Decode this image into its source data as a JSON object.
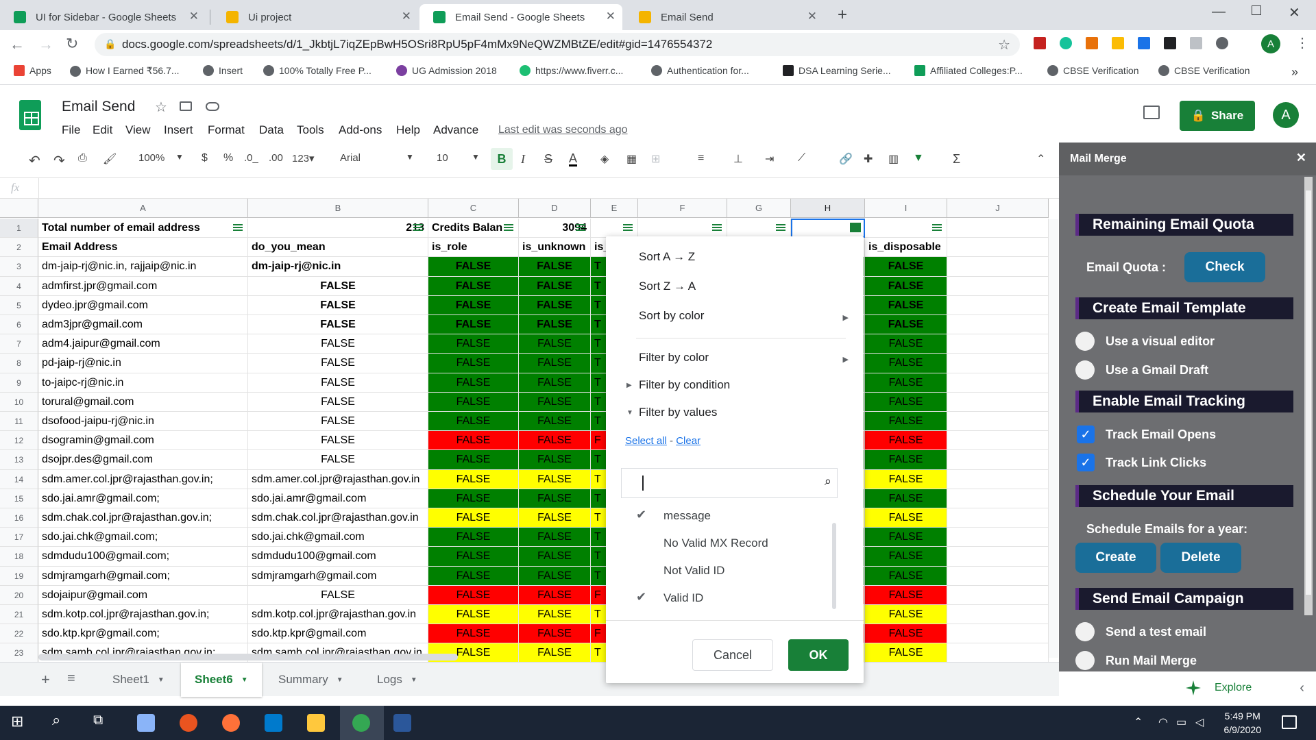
{
  "browser_tabs": [
    {
      "title": "UI for Sidebar - Google Sheets",
      "icon": "sheets-icon"
    },
    {
      "title": "Ui project",
      "icon": "slides-icon"
    },
    {
      "title": "Email Send - Google Sheets",
      "icon": "sheets-icon"
    },
    {
      "title": "Email Send",
      "icon": "slides-icon"
    }
  ],
  "url": "docs.google.com/spreadsheets/d/1_JkbtjL7iqZEpBwH5OSri8RpU5pF4mMx9NeQWZMBtZE/edit#gid=1476554372",
  "bookmarks": [
    "Apps",
    "How I Earned ₹56.7...",
    "Insert",
    "100% Totally Free P...",
    "UG Admission 2018",
    "https://www.fiverr.c...",
    "Authentication for...",
    "DSA Learning Serie...",
    "Affiliated Colleges:P...",
    "CBSE Verification",
    "CBSE Verification"
  ],
  "doc": {
    "title": "Email Send",
    "menus": [
      "File",
      "Edit",
      "View",
      "Insert",
      "Format",
      "Data",
      "Tools",
      "Add-ons",
      "Help",
      "Advance"
    ],
    "last_edit": "Last edit was seconds ago",
    "share": "Share",
    "avatar": "A"
  },
  "toolbar": {
    "zoom": "100%",
    "currency": "$",
    "percent": "%",
    "dec1": ".0_",
    "dec2": ".00",
    "fmt": "123▾",
    "font": "Arial",
    "size": "10",
    "bold": "B",
    "italic": "I",
    "strike": "S",
    "textcolor": "A"
  },
  "fx": "fx",
  "columns": [
    "A",
    "B",
    "C",
    "D",
    "E",
    "F",
    "G",
    "H",
    "I",
    "J"
  ],
  "rows": [
    {
      "n": "1",
      "a": "Total number of email address",
      "b": "213",
      "c": "Credits Balan",
      "d": "3094",
      "e": "",
      "i": ""
    },
    {
      "n": "2",
      "a": "Email Address",
      "b": "do_you_mean",
      "c": "is_role",
      "d": "is_unknown",
      "e": "is_",
      "i": "is_disposable"
    },
    {
      "n": "3",
      "a": "dm-jaip-rj@nic.in, rajjaip@nic.in",
      "b": "dm-jaip-rj@nic.in",
      "c": "FALSE",
      "d": "FALSE",
      "e": "T",
      "i": "FALSE",
      "col": "g"
    },
    {
      "n": "4",
      "a": "admfirst.jpr@gmail.com",
      "b": "FALSE",
      "c": "FALSE",
      "d": "FALSE",
      "e": "T",
      "i": "FALSE",
      "col": "g"
    },
    {
      "n": "5",
      "a": "dydeo.jpr@gmail.com",
      "b": "FALSE",
      "c": "FALSE",
      "d": "FALSE",
      "e": "T",
      "i": "FALSE",
      "col": "g"
    },
    {
      "n": "6",
      "a": "adm3jpr@gmail.com",
      "b": "FALSE",
      "c": "FALSE",
      "d": "FALSE",
      "e": "T",
      "i": "FALSE",
      "col": "g"
    },
    {
      "n": "7",
      "a": "adm4.jaipur@gmail.com",
      "b": "FALSE",
      "c": "FALSE",
      "d": "FALSE",
      "e": "T",
      "i": "FALSE",
      "col": "g"
    },
    {
      "n": "8",
      "a": "pd-jaip-rj@nic.in",
      "b": "FALSE",
      "c": "FALSE",
      "d": "FALSE",
      "e": "T",
      "i": "FALSE",
      "col": "g"
    },
    {
      "n": "9",
      "a": "to-jaipc-rj@nic.in",
      "b": "FALSE",
      "c": "FALSE",
      "d": "FALSE",
      "e": "T",
      "i": "FALSE",
      "col": "g"
    },
    {
      "n": "10",
      "a": "torural@gmail.com",
      "b": "FALSE",
      "c": "FALSE",
      "d": "FALSE",
      "e": "T",
      "i": "FALSE",
      "col": "g"
    },
    {
      "n": "11",
      "a": "dsofood-jaipu-rj@nic.in",
      "b": "FALSE",
      "c": "FALSE",
      "d": "FALSE",
      "e": "T",
      "i": "FALSE",
      "col": "g"
    },
    {
      "n": "12",
      "a": "dsogramin@gmail.com",
      "b": "FALSE",
      "c": "FALSE",
      "d": "FALSE",
      "e": "F",
      "i": "FALSE",
      "col": "rd"
    },
    {
      "n": "13",
      "a": "dsojpr.des@gmail.com",
      "b": "FALSE",
      "c": "FALSE",
      "d": "FALSE",
      "e": "T",
      "i": "FALSE",
      "col": "g"
    },
    {
      "n": "14",
      "a": "sdm.amer.col.jpr@rajasthan.gov.in;",
      "b": "sdm.amer.col.jpr@rajasthan.gov.in",
      "c": "FALSE",
      "d": "FALSE",
      "e": "T",
      "i": "FALSE",
      "col": "y"
    },
    {
      "n": "15",
      "a": "sdo.jai.amr@gmail.com;",
      "b": "sdo.jai.amr@gmail.com",
      "c": "FALSE",
      "d": "FALSE",
      "e": "T",
      "i": "FALSE",
      "col": "g"
    },
    {
      "n": "16",
      "a": "sdm.chak.col.jpr@rajasthan.gov.in;",
      "b": "sdm.chak.col.jpr@rajasthan.gov.in",
      "c": "FALSE",
      "d": "FALSE",
      "e": "T",
      "i": "FALSE",
      "col": "y"
    },
    {
      "n": "17",
      "a": "sdo.jai.chk@gmail.com;",
      "b": "sdo.jai.chk@gmail.com",
      "c": "FALSE",
      "d": "FALSE",
      "e": "T",
      "i": "FALSE",
      "col": "g"
    },
    {
      "n": "18",
      "a": "sdmdudu100@gmail.com;",
      "b": "sdmdudu100@gmail.com",
      "c": "FALSE",
      "d": "FALSE",
      "e": "T",
      "i": "FALSE",
      "col": "g"
    },
    {
      "n": "19",
      "a": "sdmjramgarh@gmail.com;",
      "b": "sdmjramgarh@gmail.com",
      "c": "FALSE",
      "d": "FALSE",
      "e": "T",
      "i": "FALSE",
      "col": "g"
    },
    {
      "n": "20",
      "a": "sdojaipur@gmail.com",
      "b": "FALSE",
      "c": "FALSE",
      "d": "FALSE",
      "e": "F",
      "i": "FALSE",
      "col": "rd"
    },
    {
      "n": "21",
      "a": "sdm.kotp.col.jpr@rajasthan.gov.in;",
      "b": "sdm.kotp.col.jpr@rajasthan.gov.in",
      "c": "FALSE",
      "d": "FALSE",
      "e": "T",
      "i": "FALSE",
      "col": "y"
    },
    {
      "n": "22",
      "a": "sdo.ktp.kpr@gmail.com;",
      "b": "sdo.ktp.kpr@gmail.com",
      "c": "FALSE",
      "d": "FALSE",
      "e": "F",
      "i": "FALSE",
      "col": "rd"
    },
    {
      "n": "23",
      "a": "sdm.samb.col.jpr@rajasthan.gov.in;",
      "b": "sdm.samb.col.jpr@rajasthan.gov.in",
      "c": "FALSE",
      "d": "FALSE",
      "e": "T",
      "i": "FALSE",
      "col": "y"
    }
  ],
  "filter_menu": {
    "sort_az": "Sort A → Z",
    "sort_za": "Sort Z → A",
    "sort_color": "Sort by color",
    "filter_color": "Filter by color",
    "filter_condition": "Filter by condition",
    "filter_values": "Filter by values",
    "select_all": "Select all",
    "dash": "-",
    "clear": "Clear",
    "values": [
      {
        "label": "message",
        "checked": true
      },
      {
        "label": "No Valid MX Record",
        "checked": false
      },
      {
        "label": "Not Valid ID",
        "checked": false
      },
      {
        "label": "Valid ID",
        "checked": true
      }
    ],
    "cancel": "Cancel",
    "ok": "OK"
  },
  "sheet_tabs": [
    "Sheet1",
    "Sheet6",
    "Summary",
    "Logs"
  ],
  "active_sheet": "Sheet6",
  "sidebar": {
    "title": "Mail Merge",
    "quota_section": "Remaining Email Quota",
    "quota_label": "Email Quota :",
    "check": "Check",
    "template_section": "Create Email Template",
    "visual_editor": "Use a visual editor",
    "gmail_draft": "Use a Gmail Draft",
    "tracking_section": "Enable Email Tracking",
    "track_opens": "Track Email Opens",
    "track_links": "Track Link Clicks",
    "schedule_section": "Schedule Your Email",
    "schedule_text": "Schedule Emails for a year:",
    "create": "Create",
    "delete": "Delete",
    "campaign_section": "Send Email Campaign",
    "test_email": "Send a test email",
    "run_merge": "Run Mail Merge"
  },
  "explore": "Explore",
  "clock": {
    "time": "5:49 PM",
    "date": "6/9/2020"
  },
  "colors": {
    "green": "#008000",
    "red": "#ff0000",
    "yellow": "#ffff00",
    "share": "#188038"
  }
}
